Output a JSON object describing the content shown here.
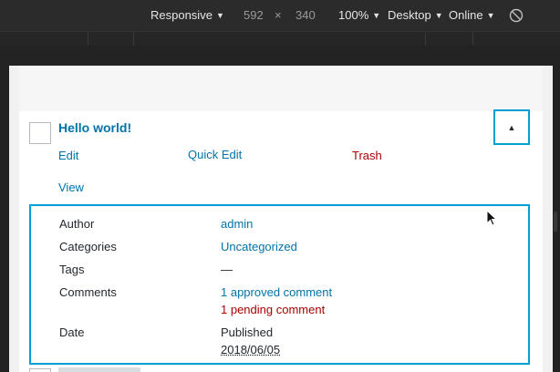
{
  "devtools": {
    "device": "Responsive",
    "width": "592",
    "times": "×",
    "height": "340",
    "zoom": "100%",
    "mode": "Desktop",
    "network": "Online",
    "rotate_icon": "rotate-icon"
  },
  "post": {
    "title": "Hello world!",
    "actions": {
      "edit": "Edit",
      "quick_edit": "Quick Edit",
      "trash": "Trash",
      "view": "View"
    },
    "toggle_icon": "triangle-up-icon"
  },
  "details": {
    "author_label": "Author",
    "author_value": "admin",
    "categories_label": "Categories",
    "categories_value": "Uncategorized",
    "tags_label": "Tags",
    "tags_value": "—",
    "comments_label": "Comments",
    "approved": "1 approved comment",
    "pending": "1 pending comment",
    "date_label": "Date",
    "date_status": "Published",
    "date_value": "2018/06/05"
  },
  "colors": {
    "link": "#0073aa",
    "trash": "#aa0000",
    "focus": "#00a0d2",
    "toolbar": "#2b2b2b"
  }
}
